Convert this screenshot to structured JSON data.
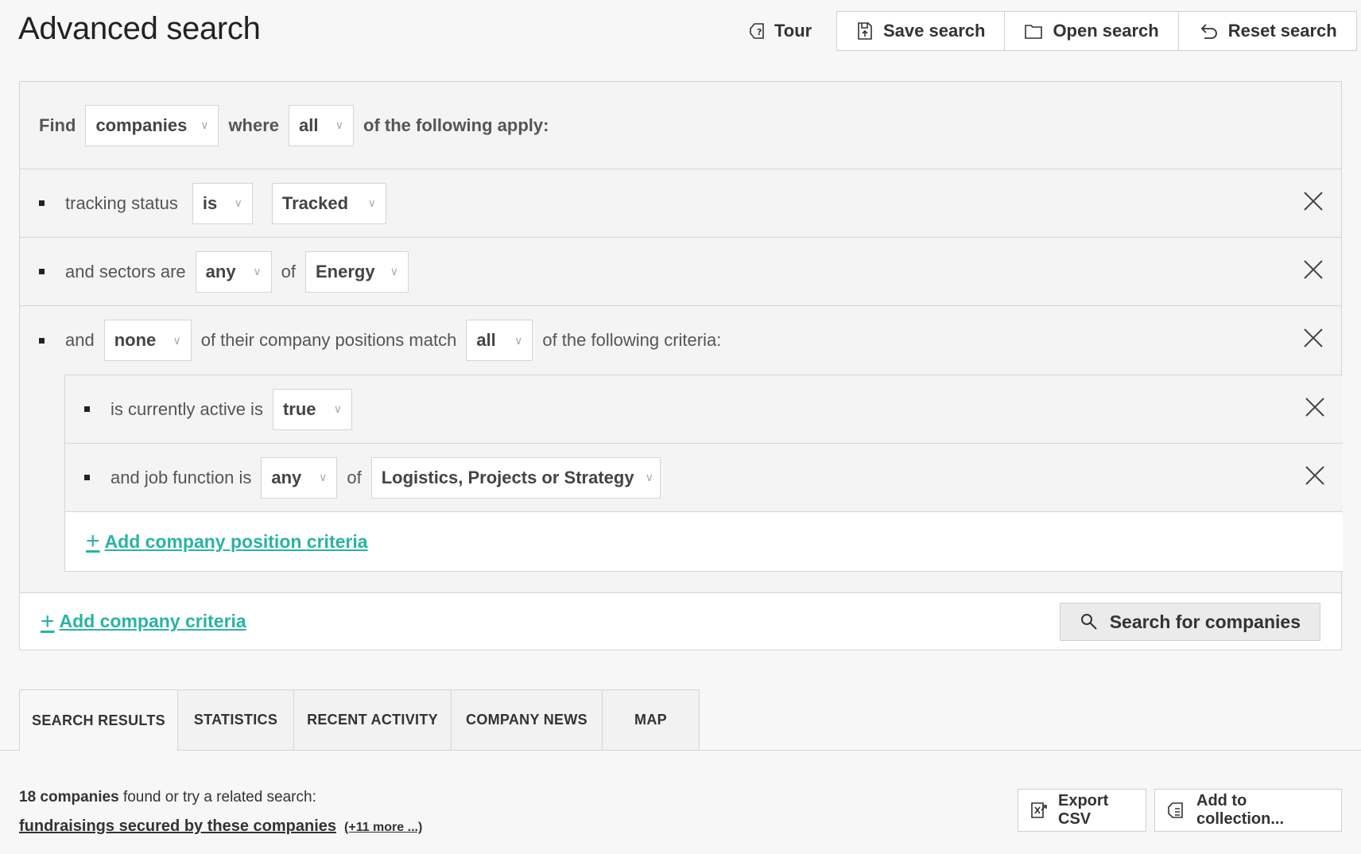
{
  "header": {
    "title": "Advanced search",
    "tour_label": "Tour",
    "save_label": "Save search",
    "open_label": "Open search",
    "reset_label": "Reset search"
  },
  "query": {
    "find_label": "Find",
    "entity": "companies",
    "where_label": "where",
    "match_mode": "all",
    "apply_label": "of the following apply:",
    "criteria": [
      {
        "label": "tracking status",
        "operator": "is",
        "value": "Tracked"
      },
      {
        "label": "and sectors are",
        "operator": "any",
        "of_label": "of",
        "value": "Energy"
      },
      {
        "label": "and",
        "operator": "none",
        "middle_label": "of their company positions match",
        "mode": "all",
        "tail_label": "of the following criteria:"
      }
    ],
    "sub_criteria": [
      {
        "label": "is currently active is",
        "value": "true"
      },
      {
        "label": "and job function is",
        "operator": "any",
        "of_label": "of",
        "value": "Logistics, Projects or Strategy"
      }
    ],
    "add_position_label": "Add company position criteria",
    "add_company_label": "Add company criteria",
    "search_button_label": "Search for companies"
  },
  "tabs": [
    {
      "label": "SEARCH RESULTS"
    },
    {
      "label": "STATISTICS"
    },
    {
      "label": "RECENT ACTIVITY"
    },
    {
      "label": "COMPANY NEWS"
    },
    {
      "label": "MAP"
    }
  ],
  "results": {
    "count_text": "18 companies",
    "suffix_text": " found or try a related search:",
    "related_link": "fundraisings secured by these companies",
    "more_link": "(+11 more ...)",
    "export_label": "Export CSV",
    "collection_label": "Add to collection..."
  },
  "colors": {
    "accent": "#2ab3a0",
    "border": "#d5d5d5",
    "background": "#f7f7f7"
  }
}
